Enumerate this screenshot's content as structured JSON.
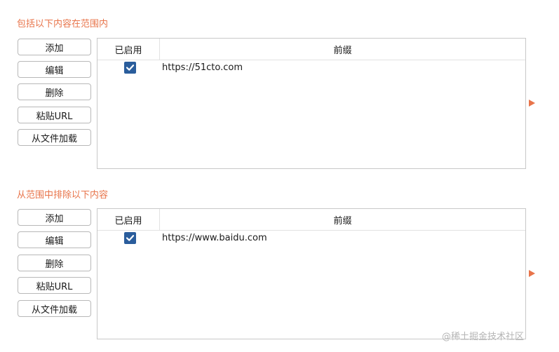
{
  "include": {
    "title": "包括以下内容在范围内",
    "buttons": [
      "添加",
      "编辑",
      "删除",
      "粘贴URL",
      "从文件加载"
    ],
    "columns": {
      "enabled": "已启用",
      "prefix": "前缀"
    },
    "rows": [
      {
        "enabled": true,
        "prefix": "https://51cto.com"
      }
    ]
  },
  "exclude": {
    "title": "从范围中排除以下内容",
    "buttons": [
      "添加",
      "编辑",
      "删除",
      "粘贴URL",
      "从文件加载"
    ],
    "columns": {
      "enabled": "已启用",
      "prefix": "前缀"
    },
    "rows": [
      {
        "enabled": true,
        "prefix": "https://www.baidu.com"
      }
    ]
  },
  "watermark": "@稀土掘金技术社区",
  "colors": {
    "accent": "#e8744a",
    "checkbox": "#2a5d9c"
  }
}
